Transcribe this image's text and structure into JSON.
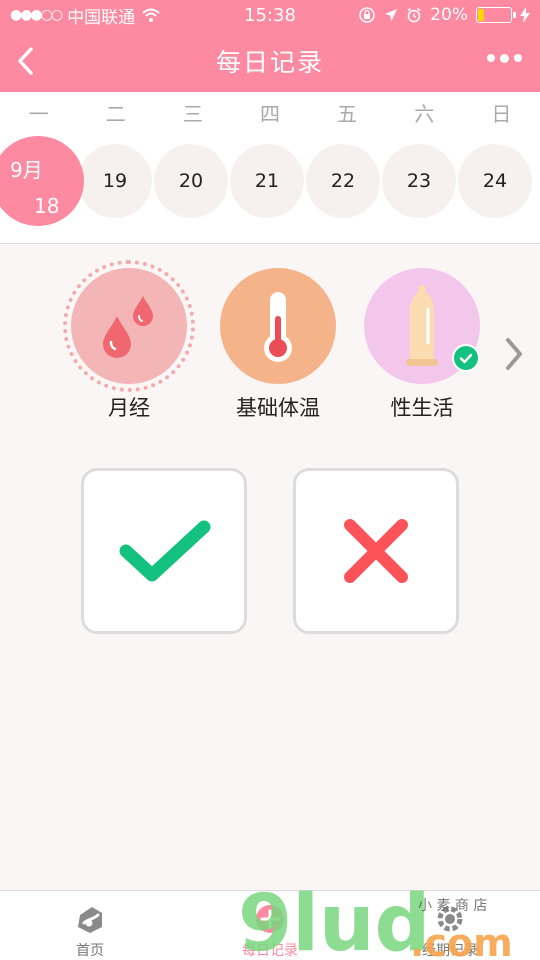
{
  "status_bar": {
    "carrier": "中国联通",
    "time": "15:38",
    "battery": "20%",
    "battery_level": 0.2
  },
  "nav": {
    "title": "每日记录"
  },
  "week": {
    "days": [
      "一",
      "二",
      "三",
      "四",
      "五",
      "六",
      "日"
    ]
  },
  "dates": {
    "selected_month": "9月",
    "selected_day": "18",
    "others": [
      "19",
      "20",
      "21",
      "22",
      "23",
      "24"
    ]
  },
  "categories": [
    {
      "label": "月经",
      "icon": "blood-drops-icon",
      "color": "#f4b5b7"
    },
    {
      "label": "基础体温",
      "icon": "thermometer-icon",
      "color": "#f5b389"
    },
    {
      "label": "性生活",
      "icon": "condom-icon",
      "color": "#f3c6ec",
      "checked": true
    }
  ],
  "choices": {
    "yes_icon": "checkmark-icon",
    "no_icon": "cross-icon",
    "yes_color": "#14c17f",
    "no_color": "#fd5257"
  },
  "tabs": [
    {
      "label": "首页",
      "icon": "home-icon"
    },
    {
      "label": "每日记录",
      "icon": "daily-record-icon",
      "active": true
    },
    {
      "label": "经期记录",
      "icon": "period-record-icon"
    }
  ],
  "watermark": {
    "brand": "9lud",
    "tld": ".com",
    "tagline": "小 素 商 店"
  },
  "colors": {
    "accent": "#fd8aa1",
    "background": "#faf6f6"
  }
}
